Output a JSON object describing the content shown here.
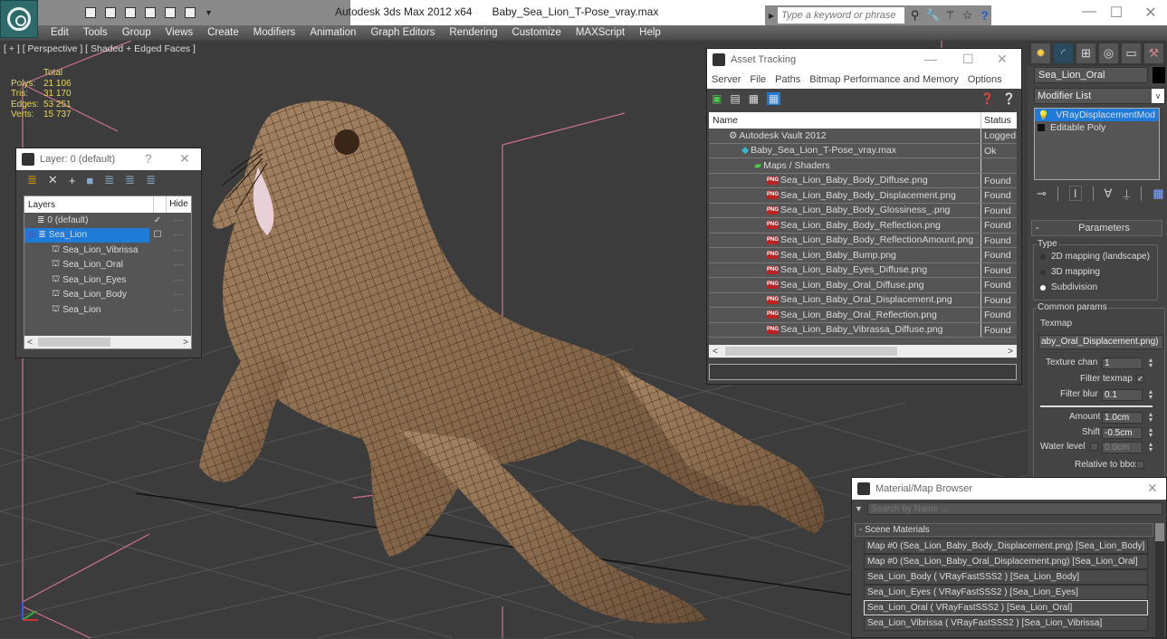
{
  "window": {
    "app_title": "Autodesk 3ds Max  2012 x64",
    "file_name": "Baby_Sea_Lion_T-Pose_vray.max",
    "search_placeholder": "Type a keyword or phrase",
    "controls": {
      "minimize": "—",
      "maximize": "☐",
      "close": "✕"
    }
  },
  "menu": [
    "Edit",
    "Tools",
    "Group",
    "Views",
    "Create",
    "Modifiers",
    "Animation",
    "Graph Editors",
    "Rendering",
    "Customize",
    "MAXScript",
    "Help"
  ],
  "viewport": {
    "label": "[ + ] [ Perspective ] [ Shaded + Edged Faces ]",
    "stats_header": "Total",
    "stats": [
      {
        "key": "Polys:",
        "value": "21 106"
      },
      {
        "key": "Tris:",
        "value": "31 170"
      },
      {
        "key": "Edges:",
        "value": "53 251"
      },
      {
        "key": "Verts:",
        "value": "15 737"
      }
    ]
  },
  "layer_dialog": {
    "title": "Layer: 0 (default)",
    "help": "?",
    "close": "✕",
    "col_layers": "Layers",
    "col_hide": "Hide",
    "rows": [
      {
        "name": "0 (default)",
        "current": "✓",
        "hide": "----",
        "level": 0,
        "selected": false
      },
      {
        "name": "Sea_Lion",
        "current": "☐",
        "hide": "----",
        "level": 0,
        "selected": true
      },
      {
        "name": "Sea_Lion_Vibrissa",
        "current": "",
        "hide": "----",
        "level": 1,
        "selected": false
      },
      {
        "name": "Sea_Lion_Oral",
        "current": "",
        "hide": "----",
        "level": 1,
        "selected": false
      },
      {
        "name": "Sea_Lion_Eyes",
        "current": "",
        "hide": "----",
        "level": 1,
        "selected": false
      },
      {
        "name": "Sea_Lion_Body",
        "current": "",
        "hide": "----",
        "level": 1,
        "selected": false
      },
      {
        "name": "Sea_Lion",
        "current": "",
        "hide": "----",
        "level": 1,
        "selected": false
      }
    ]
  },
  "asset_tracking": {
    "title": "Asset Tracking",
    "menu": [
      "Server",
      "File",
      "Paths",
      "Bitmap Performance and Memory",
      "Options"
    ],
    "col_name": "Name",
    "col_status": "Status",
    "rows": [
      {
        "name": "Autodesk Vault 2012",
        "status": "Logged",
        "indent": 1,
        "icon": "vault"
      },
      {
        "name": "Baby_Sea_Lion_T-Pose_vray.max",
        "status": "Ok",
        "indent": 2,
        "icon": "max"
      },
      {
        "name": "Maps / Shaders",
        "status": "",
        "indent": 3,
        "icon": "maps"
      },
      {
        "name": "Sea_Lion_Baby_Body_Diffuse.png",
        "status": "Found",
        "indent": 4,
        "icon": "png"
      },
      {
        "name": "Sea_Lion_Baby_Body_Displacement.png",
        "status": "Found",
        "indent": 4,
        "icon": "png"
      },
      {
        "name": "Sea_Lion_Baby_Body_Glossiness_.png",
        "status": "Found",
        "indent": 4,
        "icon": "png"
      },
      {
        "name": "Sea_Lion_Baby_Body_Reflection.png",
        "status": "Found",
        "indent": 4,
        "icon": "png"
      },
      {
        "name": "Sea_Lion_Baby_Body_ReflectionAmount.png",
        "status": "Found",
        "indent": 4,
        "icon": "png"
      },
      {
        "name": "Sea_Lion_Baby_Bump.png",
        "status": "Found",
        "indent": 4,
        "icon": "png"
      },
      {
        "name": "Sea_Lion_Baby_Eyes_Diffuse.png",
        "status": "Found",
        "indent": 4,
        "icon": "png"
      },
      {
        "name": "Sea_Lion_Baby_Oral_Diffuse.png",
        "status": "Found",
        "indent": 4,
        "icon": "png"
      },
      {
        "name": "Sea_Lion_Baby_Oral_Displacement.png",
        "status": "Found",
        "indent": 4,
        "icon": "png"
      },
      {
        "name": "Sea_Lion_Baby_Oral_Reflection.png",
        "status": "Found",
        "indent": 4,
        "icon": "png"
      },
      {
        "name": "Sea_Lion_Baby_Vibrassa_Diffuse.png",
        "status": "Found",
        "indent": 4,
        "icon": "png"
      }
    ]
  },
  "command_panel": {
    "object_name": "Sea_Lion_Oral",
    "modifier_list": "Modifier List",
    "stack": [
      {
        "name": "VRayDisplacementMod",
        "selected": true
      },
      {
        "name": "Editable Poly",
        "selected": false
      }
    ],
    "rollout_title": "Parameters",
    "type_label": "Type",
    "type_options": [
      {
        "label": "2D mapping (landscape)",
        "checked": false
      },
      {
        "label": "3D mapping",
        "checked": false
      },
      {
        "label": "Subdivision",
        "checked": true
      }
    ],
    "common_label": "Common params",
    "texmap_label": "Texmap",
    "texmap_value": "aby_Oral_Displacement.png)",
    "texture_chan_label": "Texture chan",
    "texture_chan": "1",
    "filter_texmap_label": "Filter texmap",
    "filter_texmap": "✓",
    "filter_blur_label": "Filter blur",
    "filter_blur": "0.1",
    "amount_label": "Amount",
    "amount": "1.0cm",
    "shift_label": "Shift",
    "shift": "-0.5cm",
    "water_level_label": "Water level",
    "water_level": "0.0cm",
    "relative_label": "Relative to bbox"
  },
  "material_browser": {
    "title": "Material/Map Browser",
    "search_placeholder": "Search by Name ...",
    "group": "- Scene Materials",
    "items": [
      {
        "label": "Map #0 (Sea_Lion_Baby_Body_Displacement.png) [Sea_Lion_Body]",
        "selected": false
      },
      {
        "label": "Map #0 (Sea_Lion_Baby_Oral_Displacement.png) [Sea_Lion_Oral]",
        "selected": false
      },
      {
        "label": "Sea_Lion_Body  ( VRayFastSSS2 ) [Sea_Lion_Body]",
        "selected": false
      },
      {
        "label": "Sea_Lion_Eyes  ( VRayFastSSS2 ) [Sea_Lion_Eyes]",
        "selected": false
      },
      {
        "label": "Sea_Lion_Oral  ( VRayFastSSS2 ) [Sea_Lion_Oral]",
        "selected": true
      },
      {
        "label": "Sea_Lion_Vibrissa  ( VRayFastSSS2 ) [Sea_Lion_Vibrissa]",
        "selected": false
      }
    ]
  },
  "colors": {
    "accent": "#1f7ad8",
    "stats": "#e6d65a",
    "viewport_bg": "#3c3c3c"
  }
}
